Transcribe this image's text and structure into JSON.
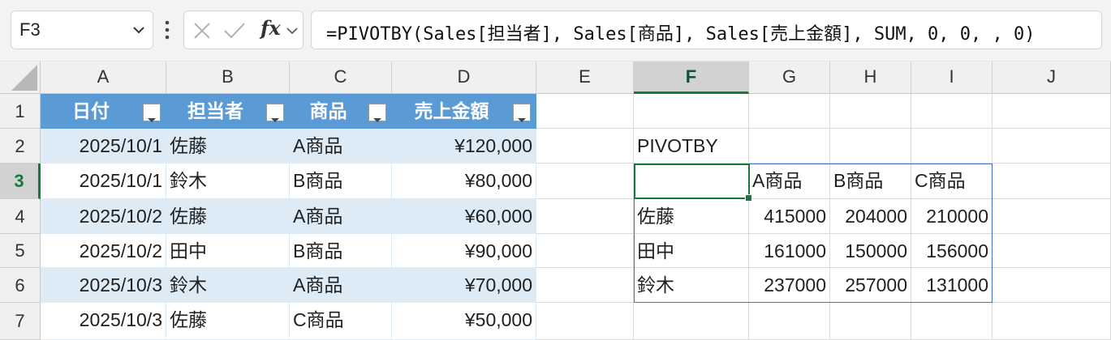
{
  "namebox": {
    "value": "F3"
  },
  "formula": {
    "text": "=PIVOTBY(Sales[担当者], Sales[商品], Sales[売上金額], SUM, 0, 0, , 0)",
    "fx_label": "fx"
  },
  "columns": [
    "A",
    "B",
    "C",
    "D",
    "E",
    "F",
    "G",
    "H",
    "I",
    "J"
  ],
  "rows": [
    "1",
    "2",
    "3",
    "4",
    "5",
    "6",
    "7"
  ],
  "active_cell": "F3",
  "table": {
    "headers": [
      "日付",
      "担当者",
      "商品",
      "売上金額"
    ],
    "rows": [
      [
        "2025/10/1",
        "佐藤",
        "A商品",
        "¥120,000"
      ],
      [
        "2025/10/1",
        "鈴木",
        "B商品",
        "¥80,000"
      ],
      [
        "2025/10/2",
        "佐藤",
        "A商品",
        "¥60,000"
      ],
      [
        "2025/10/2",
        "田中",
        "B商品",
        "¥90,000"
      ],
      [
        "2025/10/3",
        "鈴木",
        "A商品",
        "¥70,000"
      ],
      [
        "2025/10/3",
        "佐藤",
        "C商品",
        "¥50,000"
      ]
    ]
  },
  "pivot": {
    "title": "PIVOTBY",
    "col_headers": [
      "A商品",
      "B商品",
      "C商品"
    ],
    "rows": [
      {
        "label": "佐藤",
        "values": [
          "415000",
          "204000",
          "210000"
        ]
      },
      {
        "label": "田中",
        "values": [
          "161000",
          "150000",
          "156000"
        ]
      },
      {
        "label": "鈴木",
        "values": [
          "237000",
          "257000",
          "131000"
        ]
      }
    ]
  },
  "colors": {
    "table_header": "#5b9bd5",
    "table_band": "#ddebf7",
    "selection": "#137a3e",
    "pivot_border": "#4472c4"
  }
}
